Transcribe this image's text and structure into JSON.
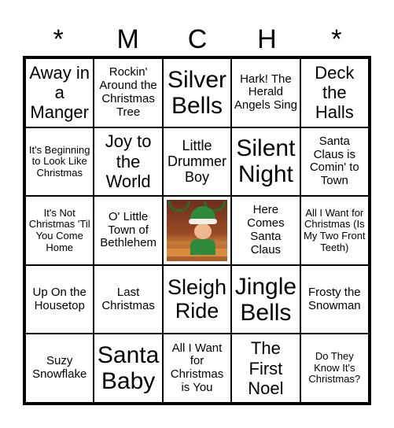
{
  "header": [
    "*",
    "M",
    "C",
    "H",
    "*"
  ],
  "cells": [
    {
      "text": "Away in a Manger",
      "size": "s2"
    },
    {
      "text": "Rockin' Around the Christmas Tree",
      "size": "s4"
    },
    {
      "text": "Silver Bells",
      "size": "s1"
    },
    {
      "text": "Hark! The Herald Angels Sing",
      "size": "s4"
    },
    {
      "text": "Deck the Halls",
      "size": "s2"
    },
    {
      "text": "It's Beginning to Look Like Christmas",
      "size": "s5"
    },
    {
      "text": "Joy to the World",
      "size": "s2"
    },
    {
      "text": "Little Drummer Boy",
      "size": "s3"
    },
    {
      "text": "Silent Night",
      "size": "s1"
    },
    {
      "text": "Santa Claus is Comin' to Town",
      "size": "s4"
    },
    {
      "text": "It's Not Christmas 'Til You Come Home",
      "size": "s5"
    },
    {
      "text": "O' Little Town of Bethlehem",
      "size": "s4"
    },
    {
      "text": "",
      "size": "free",
      "icon": "elf-image"
    },
    {
      "text": "Here Comes Santa Claus",
      "size": "s4"
    },
    {
      "text": "All I Want for Christmas (Is My Two Front Teeth)",
      "size": "s5"
    },
    {
      "text": "Up On the Housetop",
      "size": "s4"
    },
    {
      "text": "Last Christmas",
      "size": "s4"
    },
    {
      "text": "Sleigh Ride",
      "size": "s2x"
    },
    {
      "text": "Jingle Bells",
      "size": "s1"
    },
    {
      "text": "Frosty the Snowman",
      "size": "s4"
    },
    {
      "text": "Suzy Snowflake",
      "size": "s4"
    },
    {
      "text": "Santa Baby",
      "size": "s1"
    },
    {
      "text": "All I Want for Christmas is You",
      "size": "s4"
    },
    {
      "text": "The First Noel",
      "size": "s2"
    },
    {
      "text": "Do They Know It's Christmas?",
      "size": "s5"
    }
  ]
}
